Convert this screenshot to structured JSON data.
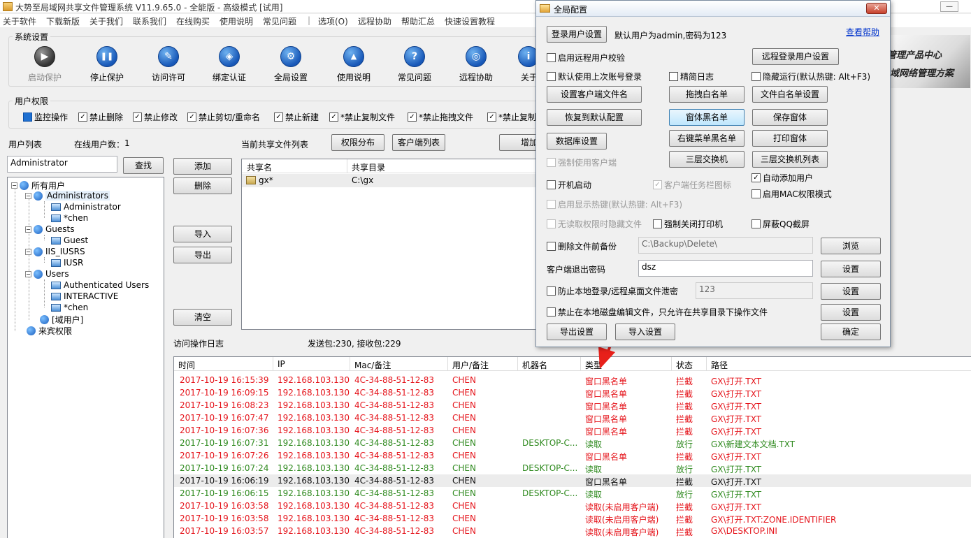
{
  "window": {
    "title": "大势至局域网共享文件管理系统 V11.9.65.0 - 全能版 - 高级模式 [试用]",
    "min": "—",
    "close": "✕"
  },
  "menu": [
    "关于软件",
    "下载新版",
    "关于我们",
    "联系我们",
    "在线购买",
    "使用说明",
    "常见问题",
    "|",
    "选项(O)",
    "远程协助",
    "帮助汇总",
    "快速设置教程"
  ],
  "toolbar": {
    "group_title": "系统设置",
    "buttons": [
      {
        "label": "启动保护",
        "icon": "play-icon",
        "glyph": "▶"
      },
      {
        "label": "停止保护",
        "icon": "pause-icon",
        "glyph": "❚❚"
      },
      {
        "label": "访问许可",
        "icon": "key-icon",
        "glyph": "✎"
      },
      {
        "label": "绑定认证",
        "icon": "shield-icon",
        "glyph": "◈"
      },
      {
        "label": "全局设置",
        "icon": "gear-icon",
        "glyph": "⚙"
      },
      {
        "label": "使用说明",
        "icon": "graduation-icon",
        "glyph": "▲"
      },
      {
        "label": "常见问题",
        "icon": "question-icon",
        "glyph": "?"
      },
      {
        "label": "远程协助",
        "icon": "globe-icon",
        "glyph": "◎"
      },
      {
        "label": "关于",
        "icon": "info-icon",
        "glyph": "i"
      }
    ],
    "banner_line1": "管理产品中心",
    "banner_line2": "域网络管理方案"
  },
  "permissions": {
    "group_title": "用户权限",
    "items": [
      {
        "label": "监控操作",
        "checked": "fill"
      },
      {
        "label": "禁止删除",
        "checked": "✓"
      },
      {
        "label": "禁止修改",
        "checked": "✓"
      },
      {
        "label": "禁止剪切/重命名",
        "checked": "✓"
      },
      {
        "label": "禁止新建",
        "checked": "✓"
      },
      {
        "label": "*禁止复制文件",
        "checked": "✓"
      },
      {
        "label": "*禁止拖拽文件",
        "checked": "✓"
      },
      {
        "label": "*禁止复制",
        "checked": "✓"
      }
    ]
  },
  "users": {
    "list_label": "用户列表",
    "online_label": "在线用户数：",
    "online_count": "1",
    "search_value": "Administrator",
    "search_button": "查找",
    "tree": {
      "root": "所有用户",
      "groups": [
        {
          "name": "Administrators",
          "members": [
            "Administrator",
            "*chen"
          ]
        },
        {
          "name": "Guests",
          "members": [
            "Guest"
          ]
        },
        {
          "name": "IIS_IUSRS",
          "members": [
            "IUSR"
          ]
        },
        {
          "name": "Users",
          "members": [
            "Authenticated Users",
            "INTERACTIVE",
            "*chen"
          ]
        },
        {
          "name": "[域用户]",
          "members": []
        }
      ],
      "guest": "来宾权限"
    }
  },
  "side_buttons": {
    "add": "添加",
    "delete": "删除",
    "import": "导入",
    "export": "导出",
    "clear": "清空"
  },
  "shares": {
    "label": "当前共享文件列表",
    "perm_button": "权限分布",
    "client_button": "客户端列表",
    "add_button": "增加",
    "col_name": "共享名",
    "col_dir": "共享目录",
    "rows": [
      {
        "name": "gx*",
        "dir": "C:\\gx"
      }
    ]
  },
  "log": {
    "label": "访问操作日志",
    "stats": "发送包:230, 接收包:229",
    "columns": [
      "时间",
      "IP",
      "Mac/备注",
      "用户/备注",
      "机器名",
      "类型",
      "状态",
      "路径"
    ],
    "rows": [
      {
        "time": "2017-10-19 16:15:39",
        "ip": "192.168.103.130",
        "mac": "4C-34-88-51-12-83",
        "user": "CHEN",
        "machine": "",
        "type": "窗口黑名单",
        "status": "拦截",
        "path": "GX\\打开.TXT",
        "color": "red"
      },
      {
        "time": "2017-10-19 16:09:15",
        "ip": "192.168.103.130",
        "mac": "4C-34-88-51-12-83",
        "user": "CHEN",
        "machine": "",
        "type": "窗口黑名单",
        "status": "拦截",
        "path": "GX\\打开.TXT",
        "color": "red"
      },
      {
        "time": "2017-10-19 16:08:23",
        "ip": "192.168.103.130",
        "mac": "4C-34-88-51-12-83",
        "user": "CHEN",
        "machine": "",
        "type": "窗口黑名单",
        "status": "拦截",
        "path": "GX\\打开.TXT",
        "color": "red"
      },
      {
        "time": "2017-10-19 16:07:47",
        "ip": "192.168.103.130",
        "mac": "4C-34-88-51-12-83",
        "user": "CHEN",
        "machine": "",
        "type": "窗口黑名单",
        "status": "拦截",
        "path": "GX\\打开.TXT",
        "color": "red"
      },
      {
        "time": "2017-10-19 16:07:36",
        "ip": "192.168.103.130",
        "mac": "4C-34-88-51-12-83",
        "user": "CHEN",
        "machine": "",
        "type": "窗口黑名单",
        "status": "拦截",
        "path": "GX\\打开.TXT",
        "color": "red"
      },
      {
        "time": "2017-10-19 16:07:31",
        "ip": "192.168.103.130",
        "mac": "4C-34-88-51-12-83",
        "user": "CHEN",
        "machine": "DESKTOP-C...",
        "type": "读取",
        "status": "放行",
        "path": "GX\\新建文本文档.TXT",
        "color": "grn"
      },
      {
        "time": "2017-10-19 16:07:26",
        "ip": "192.168.103.130",
        "mac": "4C-34-88-51-12-83",
        "user": "CHEN",
        "machine": "",
        "type": "窗口黑名单",
        "status": "拦截",
        "path": "GX\\打开.TXT",
        "color": "red"
      },
      {
        "time": "2017-10-19 16:07:24",
        "ip": "192.168.103.130",
        "mac": "4C-34-88-51-12-83",
        "user": "CHEN",
        "machine": "DESKTOP-C...",
        "type": "读取",
        "status": "放行",
        "path": "GX\\打开.TXT",
        "color": "grn"
      },
      {
        "time": "2017-10-19 16:06:19",
        "ip": "192.168.103.130",
        "mac": "4C-34-88-51-12-83",
        "user": "CHEN",
        "machine": "",
        "type": "窗口黑名单",
        "status": "拦截",
        "path": "GX\\打开.TXT",
        "color": "blk"
      },
      {
        "time": "2017-10-19 16:06:15",
        "ip": "192.168.103.130",
        "mac": "4C-34-88-51-12-83",
        "user": "CHEN",
        "machine": "DESKTOP-C...",
        "type": "读取",
        "status": "放行",
        "path": "GX\\打开.TXT",
        "color": "grn"
      },
      {
        "time": "2017-10-19 16:03:58",
        "ip": "192.168.103.130",
        "mac": "4C-34-88-51-12-83",
        "user": "CHEN",
        "machine": "",
        "type": "读取(未启用客户端)",
        "status": "拦截",
        "path": "GX\\打开.TXT",
        "color": "red"
      },
      {
        "time": "2017-10-19 16:03:58",
        "ip": "192.168.103.130",
        "mac": "4C-34-88-51-12-83",
        "user": "CHEN",
        "machine": "",
        "type": "读取(未启用客户端)",
        "status": "拦截",
        "path": "GX\\打开.TXT:ZONE.IDENTIFIER",
        "color": "red"
      },
      {
        "time": "2017-10-19 16:03:57",
        "ip": "192.168.103.130",
        "mac": "4C-34-88-51-12-83",
        "user": "CHEN",
        "machine": "",
        "type": "读取(未启用客户端)",
        "status": "拦截",
        "path": "GX\\DESKTOP.INI",
        "color": "red"
      }
    ]
  },
  "dialog": {
    "title": "全局配置",
    "close": "✕",
    "login_button": "登录用户设置",
    "default_text": "默认用户为admin,密码为123",
    "help_link": "查看帮助",
    "remote_verify": "启用远程用户校验",
    "remote_login_button": "远程登录用户设置",
    "last_login": "默认使用上次账号登录",
    "simple_log": "精简日志",
    "hidden_run": "隐藏运行(默认热键: Alt+F3)",
    "client_file_button": "设置客户端文件名",
    "drag_white_button": "拖拽白名单",
    "file_white_button": "文件白名单设置",
    "restore_button": "恢复到默认配置",
    "window_black_button": "窗体黑名单",
    "save_window_button": "保存窗体",
    "db_button": "数据库设置",
    "right_menu_button": "右键菜单黑名单",
    "print_window_button": "打印窗体",
    "force_client": "强制使用客户端",
    "l3_switch_button": "三层交换机",
    "l3_list_button": "三层交换机列表",
    "auto_add_user": "自动添加用户",
    "autostart": "开机启动",
    "tray_icon": "客户端任务栏图标",
    "mac_mode": "启用MAC权限模式",
    "show_hotkey": "启用显示热键(默认热键: Alt+F3)",
    "hide_no_perm": "无读取权限时隐藏文件",
    "force_close_printer": "强制关闭打印机",
    "block_qq": "屏蔽QQ截屏",
    "backup_before_delete": "删除文件前备份",
    "backup_path": "C:\\Backup\\Delete\\",
    "browse_button": "浏览",
    "exit_pwd_label": "客户端退出密码",
    "exit_pwd": "dsz",
    "set_button": "设置",
    "prevent_leak": "防止本地登录/远程桌面文件泄密",
    "leak_pwd": "123",
    "no_local_edit": "禁止在本地磁盘编辑文件，只允许在共享目录下操作文件",
    "export_button": "导出设置",
    "import_button": "导入设置",
    "ok_button": "确定"
  },
  "colors": {
    "red": "#e5141b",
    "green": "#2f8a1f",
    "arrow": "#e8201a",
    "accent": "#1e6fd0"
  }
}
